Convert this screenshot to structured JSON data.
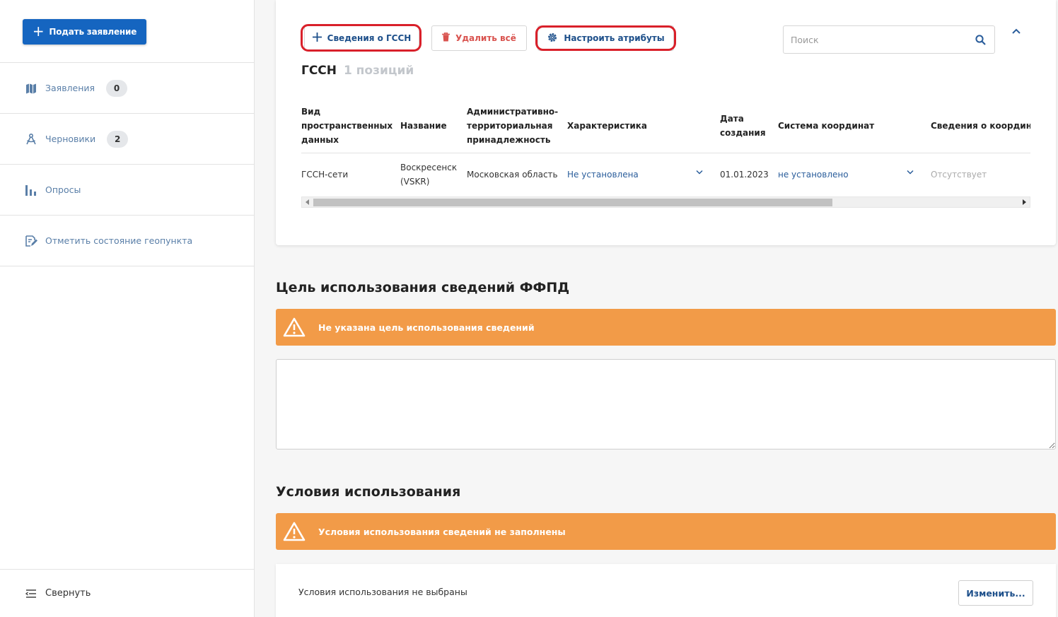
{
  "sidebar": {
    "submit_label": "Подать заявление",
    "items": [
      {
        "label": "Заявления",
        "badge": "0",
        "icon": "map-icon"
      },
      {
        "label": "Черновики",
        "badge": "2",
        "icon": "compass-icon"
      },
      {
        "label": "Опросы",
        "icon": "bar-chart-icon"
      },
      {
        "label": "Отметить состояние геопункта",
        "icon": "edit-document-icon"
      }
    ],
    "collapse_label": "Свернуть"
  },
  "card": {
    "add_label": "Сведения о ГССН",
    "delete_label": "Удалить всё",
    "attributes_label": "Настроить атрибуты",
    "search_placeholder": "Поиск",
    "title": "ГССН",
    "count": "1 позиций"
  },
  "table": {
    "headers": [
      "Вид пространственных данных",
      "Название",
      "Административно-территориальная принадлежность",
      "Характеристика",
      "Дата создания",
      "Система координат",
      "Сведения о координатах"
    ],
    "rows": [
      {
        "type": "ГССН-сети",
        "name": "Воскресенск (VSKR)",
        "admin": "Московская область",
        "characteristic": "Не установлена",
        "date": "01.01.2023",
        "coord_system": "не установлено",
        "coord_info": "Отсутствует"
      }
    ]
  },
  "purpose": {
    "title": "Цель использования сведений ФФПД",
    "alert": "Не указана цель использования сведений",
    "text_value": ""
  },
  "terms": {
    "title": "Условия использования",
    "alert": "Условия использования сведений не заполнены",
    "status_text": "Условия использования не выбраны",
    "change_label": "Изменить..."
  },
  "colors": {
    "primary": "#1565c0",
    "link": "#2a5d9b",
    "warning": "#f29b48",
    "danger": "#d9534f",
    "highlight": "#d9202a"
  }
}
